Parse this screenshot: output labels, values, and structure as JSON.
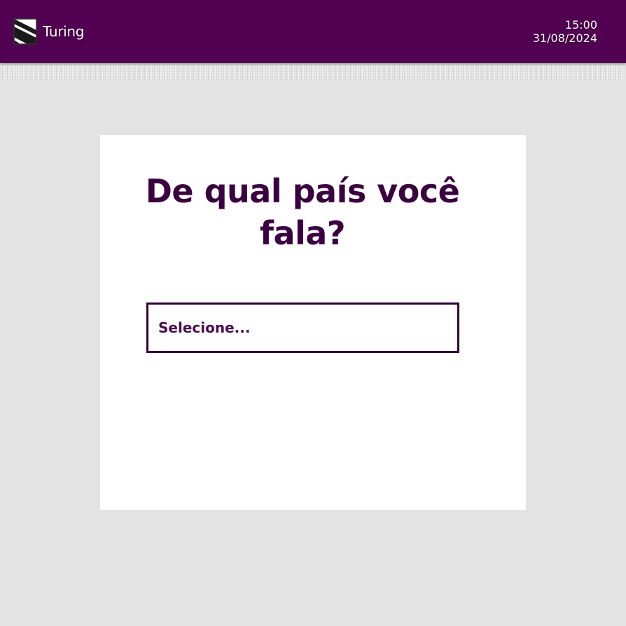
{
  "header": {
    "app_name": "Turing",
    "logo_icon": "turing-logo-icon",
    "time": "15:00",
    "date": "31/08/2024",
    "background_color": "#520052"
  },
  "main": {
    "question": "De qual país você fala?",
    "country_select": {
      "placeholder": "Selecione..."
    },
    "question_color": "#3a0040"
  }
}
